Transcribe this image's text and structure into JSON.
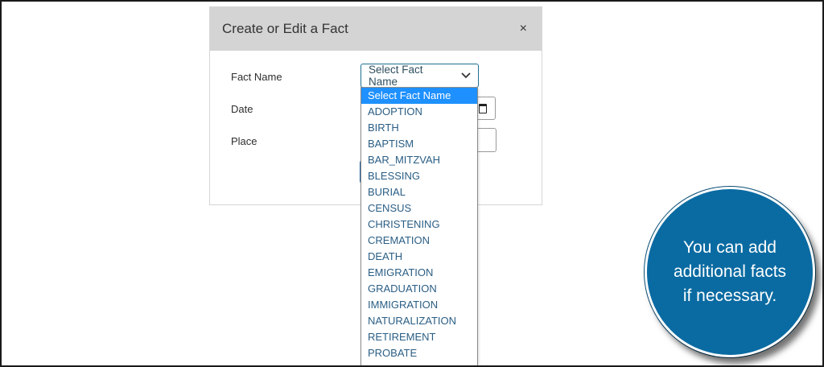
{
  "modal": {
    "title": "Create or Edit a Fact",
    "close_label": "×",
    "labels": {
      "fact_name": "Fact Name",
      "date": "Date",
      "place": "Place"
    }
  },
  "fact_select": {
    "selected": "Select Fact Name",
    "options": [
      "Select Fact Name",
      "ADOPTION",
      "BIRTH",
      "BAPTISM",
      "BAR_MITZVAH",
      "BLESSING",
      "BURIAL",
      "CENSUS",
      "CHRISTENING",
      "CREMATION",
      "DEATH",
      "EMIGRATION",
      "GRADUATION",
      "IMMIGRATION",
      "NATURALIZATION",
      "RETIREMENT",
      "PROBATE"
    ],
    "highlighted_index": 0
  },
  "callout": {
    "lines": [
      "You can add",
      "additional facts",
      "if necessary."
    ],
    "color": "#0a6ba2"
  },
  "colors": {
    "header_bg": "#d4d4d4",
    "selected_option_bg": "#1e90ff",
    "option_text": "#2a5e85"
  }
}
